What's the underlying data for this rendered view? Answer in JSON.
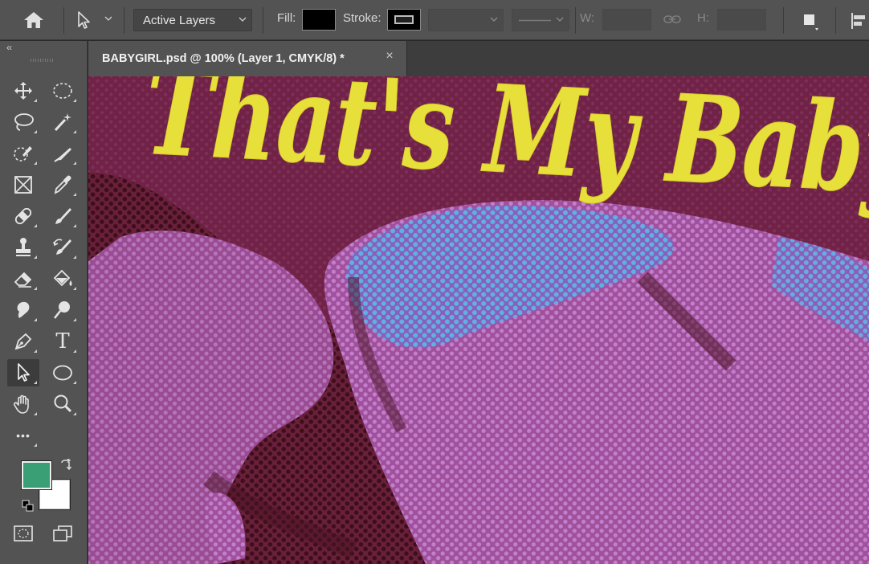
{
  "options_bar": {
    "tool_preset_icon": "direct-selection-arrow-icon",
    "select_mode_value": "Active Layers",
    "fill_label": "Fill:",
    "stroke_label": "Stroke:",
    "width_label": "W:",
    "height_label": "H:",
    "link_icon": "link-icon",
    "fill_color": "#000000",
    "stroke_color": "#000000"
  },
  "document": {
    "tab_title": "BABYGIRL.psd @ 100% (Layer 1, CMYK/8) *",
    "close_glyph": "×",
    "canvas_text": "That's My Baby"
  },
  "toolbar": {
    "collapse_glyph": "‹‹",
    "tools": [
      {
        "name": "move-tool",
        "icon": "move-icon"
      },
      {
        "name": "elliptical-marquee-tool",
        "icon": "ellipse-marquee-icon"
      },
      {
        "name": "lasso-tool",
        "icon": "lasso-icon"
      },
      {
        "name": "magic-wand-tool",
        "icon": "magic-wand-icon"
      },
      {
        "name": "quick-selection-tool",
        "icon": "quick-selection-icon"
      },
      {
        "name": "slice-tool",
        "icon": "knife-icon"
      },
      {
        "name": "frame-tool",
        "icon": "frame-icon"
      },
      {
        "name": "eyedropper-tool",
        "icon": "eyedropper-icon"
      },
      {
        "name": "spot-healing-tool",
        "icon": "bandage-icon"
      },
      {
        "name": "brush-tool",
        "icon": "brush-icon"
      },
      {
        "name": "clone-stamp-tool",
        "icon": "stamp-icon"
      },
      {
        "name": "history-brush-tool",
        "icon": "history-brush-icon"
      },
      {
        "name": "eraser-tool",
        "icon": "eraser-icon"
      },
      {
        "name": "paint-bucket-tool",
        "icon": "paint-bucket-icon"
      },
      {
        "name": "smudge-tool",
        "icon": "smudge-icon"
      },
      {
        "name": "dodge-tool",
        "icon": "dodge-icon"
      },
      {
        "name": "pen-tool",
        "icon": "pen-icon"
      },
      {
        "name": "type-tool",
        "icon": "type-icon"
      },
      {
        "name": "direct-selection-tool",
        "icon": "arrow-icon"
      },
      {
        "name": "ellipse-tool",
        "icon": "ellipse-icon"
      },
      {
        "name": "hand-tool",
        "icon": "hand-icon"
      },
      {
        "name": "zoom-tool",
        "icon": "zoom-icon"
      },
      {
        "name": "edit-toolbar",
        "icon": "more-icon"
      }
    ],
    "type_glyph": "T",
    "more_glyph": "•••",
    "foreground_color": "#3a9f74",
    "background_color": "#ffffff"
  }
}
